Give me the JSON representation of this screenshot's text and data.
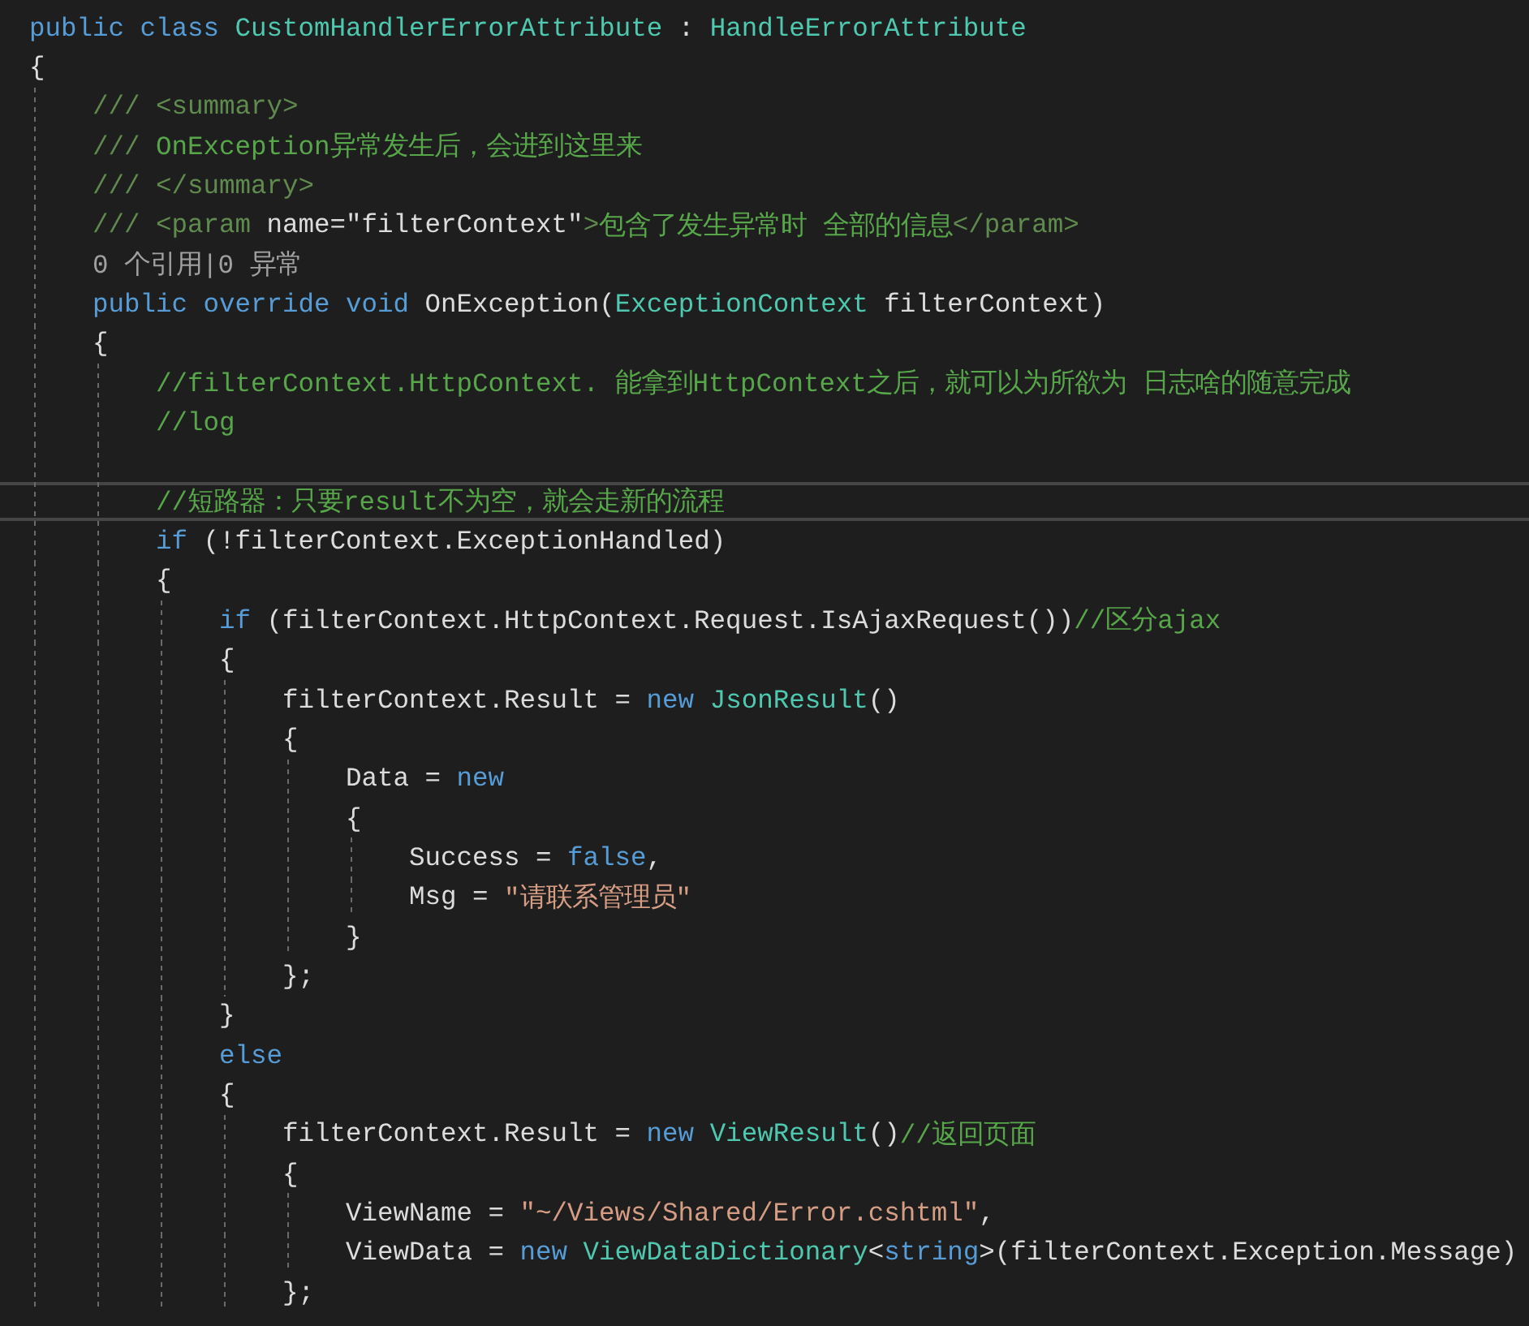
{
  "editor": {
    "lines": [
      {
        "current": false,
        "tokens": [
          {
            "kind": "keyword",
            "text": "public class "
          },
          {
            "kind": "type",
            "text": "CustomHandlerErrorAttribute"
          },
          {
            "kind": "plain",
            "text": " : "
          },
          {
            "kind": "type",
            "text": "HandleErrorAttribute"
          }
        ]
      },
      {
        "current": false,
        "tokens": [
          {
            "kind": "plain",
            "text": "{"
          }
        ],
        "children": [
          {
            "current": false,
            "tokens": [
              {
                "kind": "doc",
                "text": "/// <summary>"
              }
            ]
          },
          {
            "current": false,
            "tokens": [
              {
                "kind": "doc",
                "text": "/// "
              },
              {
                "kind": "comment",
                "text": "OnException异常发生后，会进到这里来"
              }
            ]
          },
          {
            "current": false,
            "tokens": [
              {
                "kind": "doc",
                "text": "/// </summary>"
              }
            ]
          },
          {
            "current": false,
            "tokens": [
              {
                "kind": "doc",
                "text": "/// <param "
              },
              {
                "kind": "plain",
                "text": "name=\"filterContext\""
              },
              {
                "kind": "doc",
                "text": ">"
              },
              {
                "kind": "comment",
                "text": "包含了发生异常时 全部的信息"
              },
              {
                "kind": "doc",
                "text": "</param>"
              }
            ]
          },
          {
            "current": false,
            "tokens": [
              {
                "kind": "lens",
                "text": "0 个引用|0 异常"
              }
            ]
          },
          {
            "current": false,
            "tokens": [
              {
                "kind": "keyword",
                "text": "public override void "
              },
              {
                "kind": "plain",
                "text": "OnException("
              },
              {
                "kind": "type",
                "text": "ExceptionContext"
              },
              {
                "kind": "plain",
                "text": " filterContext)"
              }
            ]
          },
          {
            "current": false,
            "tokens": [
              {
                "kind": "plain",
                "text": "{"
              }
            ],
            "children": [
              {
                "current": false,
                "tokens": [
                  {
                    "kind": "comment",
                    "text": "//filterContext.HttpContext. 能拿到HttpContext之后，就可以为所欲为 日志啥的随意完成"
                  }
                ]
              },
              {
                "current": false,
                "tokens": [
                  {
                    "kind": "comment",
                    "text": "//log"
                  }
                ]
              },
              {
                "kind": "blank"
              },
              {
                "current": true,
                "tokens": [
                  {
                    "kind": "comment",
                    "text": "//短路器：只要result不为空，就会走新的流程"
                  }
                ]
              },
              {
                "current": false,
                "tokens": [
                  {
                    "kind": "keyword",
                    "text": "if "
                  },
                  {
                    "kind": "plain",
                    "text": "(!filterContext.ExceptionHandled)"
                  }
                ]
              },
              {
                "current": false,
                "tokens": [
                  {
                    "kind": "plain",
                    "text": "{"
                  }
                ],
                "children": [
                  {
                    "current": false,
                    "tokens": [
                      {
                        "kind": "keyword",
                        "text": "if "
                      },
                      {
                        "kind": "plain",
                        "text": "(filterContext.HttpContext.Request.IsAjaxRequest())"
                      },
                      {
                        "kind": "comment",
                        "text": "//区分ajax"
                      }
                    ]
                  },
                  {
                    "current": false,
                    "tokens": [
                      {
                        "kind": "plain",
                        "text": "{"
                      }
                    ],
                    "children": [
                      {
                        "current": false,
                        "tokens": [
                          {
                            "kind": "plain",
                            "text": "filterContext.Result = "
                          },
                          {
                            "kind": "keyword",
                            "text": "new "
                          },
                          {
                            "kind": "type",
                            "text": "JsonResult"
                          },
                          {
                            "kind": "plain",
                            "text": "()"
                          }
                        ]
                      },
                      {
                        "current": false,
                        "tokens": [
                          {
                            "kind": "plain",
                            "text": "{"
                          }
                        ],
                        "children": [
                          {
                            "current": false,
                            "tokens": [
                              {
                                "kind": "plain",
                                "text": "Data = "
                              },
                              {
                                "kind": "keyword",
                                "text": "new"
                              }
                            ]
                          },
                          {
                            "current": false,
                            "tokens": [
                              {
                                "kind": "plain",
                                "text": "{"
                              }
                            ],
                            "children": [
                              {
                                "current": false,
                                "tokens": [
                                  {
                                    "kind": "plain",
                                    "text": "Success = "
                                  },
                                  {
                                    "kind": "keyword",
                                    "text": "false"
                                  },
                                  {
                                    "kind": "plain",
                                    "text": ","
                                  }
                                ]
                              },
                              {
                                "current": false,
                                "tokens": [
                                  {
                                    "kind": "plain",
                                    "text": "Msg = "
                                  },
                                  {
                                    "kind": "string",
                                    "text": "\"请联系管理员\""
                                  }
                                ]
                              }
                            ]
                          },
                          {
                            "current": false,
                            "tokens": [
                              {
                                "kind": "plain",
                                "text": "}"
                              }
                            ]
                          }
                        ]
                      },
                      {
                        "current": false,
                        "tokens": [
                          {
                            "kind": "plain",
                            "text": "};"
                          }
                        ]
                      }
                    ]
                  },
                  {
                    "current": false,
                    "tokens": [
                      {
                        "kind": "plain",
                        "text": "}"
                      }
                    ]
                  },
                  {
                    "current": false,
                    "tokens": [
                      {
                        "kind": "keyword",
                        "text": "else"
                      }
                    ]
                  },
                  {
                    "current": false,
                    "tokens": [
                      {
                        "kind": "plain",
                        "text": "{"
                      }
                    ],
                    "children": [
                      {
                        "current": false,
                        "tokens": [
                          {
                            "kind": "plain",
                            "text": "filterContext.Result = "
                          },
                          {
                            "kind": "keyword",
                            "text": "new "
                          },
                          {
                            "kind": "type",
                            "text": "ViewResult"
                          },
                          {
                            "kind": "plain",
                            "text": "()"
                          },
                          {
                            "kind": "comment",
                            "text": "//返回页面"
                          }
                        ]
                      },
                      {
                        "current": false,
                        "tokens": [
                          {
                            "kind": "plain",
                            "text": "{"
                          }
                        ],
                        "children": [
                          {
                            "current": false,
                            "tokens": [
                              {
                                "kind": "plain",
                                "text": "ViewName = "
                              },
                              {
                                "kind": "string",
                                "text": "\"~/Views/Shared/Error.cshtml\""
                              },
                              {
                                "kind": "plain",
                                "text": ","
                              }
                            ]
                          },
                          {
                            "current": false,
                            "tokens": [
                              {
                                "kind": "plain",
                                "text": "ViewData = "
                              },
                              {
                                "kind": "keyword",
                                "text": "new "
                              },
                              {
                                "kind": "type",
                                "text": "ViewDataDictionary"
                              },
                              {
                                "kind": "plain",
                                "text": "<"
                              },
                              {
                                "kind": "keyword",
                                "text": "string"
                              },
                              {
                                "kind": "plain",
                                "text": ">(filterContext.Exception.Message)"
                              }
                            ]
                          }
                        ]
                      },
                      {
                        "current": false,
                        "tokens": [
                          {
                            "kind": "plain",
                            "text": "};"
                          }
                        ]
                      }
                    ]
                  }
                ]
              }
            ]
          }
        ]
      }
    ]
  }
}
